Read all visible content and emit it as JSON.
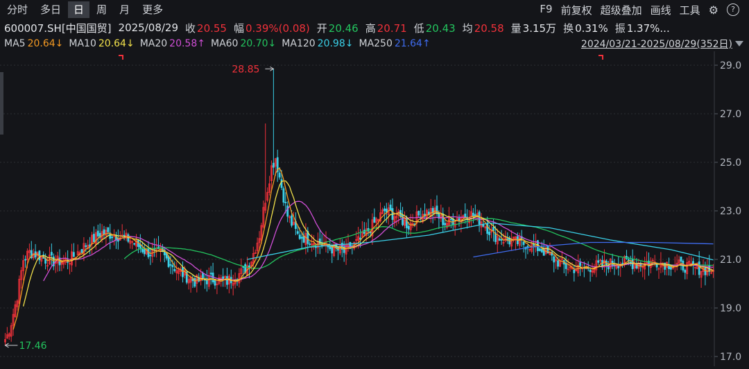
{
  "toolbar": {
    "tabs": [
      {
        "label": "分时",
        "active": false
      },
      {
        "label": "多日",
        "active": false
      },
      {
        "label": "日",
        "active": true
      },
      {
        "label": "周",
        "active": false
      },
      {
        "label": "月",
        "active": false
      },
      {
        "label": "更多",
        "active": false
      }
    ],
    "tools": [
      "F9",
      "前复权",
      "超级叠加",
      "画线",
      "工具"
    ],
    "settings_icon": "gear-icon",
    "help_icon": "question-icon",
    "help_glyph": "?"
  },
  "quote": {
    "symbol": "600007.SH[中国国贸]",
    "date": "2025/08/29",
    "close_label": "收",
    "close": "20.55",
    "change_label": "幅",
    "change": "0.39%(0.08)",
    "open_label": "开",
    "open": "20.46",
    "high_label": "高",
    "high": "20.71",
    "low_label": "低",
    "low": "20.43",
    "avg_label": "均",
    "avg": "20.58",
    "volume_label": "量",
    "volume": "3.15万",
    "turnover_label": "换",
    "turnover": "0.31%",
    "amplitude_label": "振",
    "amplitude": "1.37%..."
  },
  "ma_bar": {
    "items": [
      {
        "name": "MA5",
        "value": "20.64↓",
        "color": "#f59a23"
      },
      {
        "name": "MA10",
        "value": "20.64↓",
        "color": "#f2e14b"
      },
      {
        "name": "MA20",
        "value": "20.58↑",
        "color": "#d04fd6"
      },
      {
        "name": "MA60",
        "value": "20.70↓",
        "color": "#23c45e"
      },
      {
        "name": "MA120",
        "value": "20.98↓",
        "color": "#3ad0e8"
      },
      {
        "name": "MA250",
        "value": "21.64↑",
        "color": "#3f6cf0"
      }
    ],
    "range": "2024/03/21-2025/08/29(352日)"
  },
  "colors": {
    "up": "#f0313a",
    "down": "#3ad0e8",
    "grid": "#2c2e34",
    "axis_text": "#b4b8c0"
  },
  "chart_data": {
    "type": "candlestick",
    "y_ticks": [
      "29.0",
      "27.0",
      "25.0",
      "23.0",
      "21.0",
      "19.0",
      "17.0"
    ],
    "ylim": [
      17.0,
      29.0
    ],
    "high_marker": "28.85",
    "low_marker": "17.46",
    "high_value": 28.85,
    "low_value": 17.46,
    "sessions": 352,
    "close_path": [
      [
        0,
        17.6
      ],
      [
        3,
        18.4
      ],
      [
        6,
        19.5
      ],
      [
        9,
        21.0
      ],
      [
        12,
        21.3
      ],
      [
        16,
        21.2
      ],
      [
        20,
        21.0
      ],
      [
        25,
        20.9
      ],
      [
        32,
        21.0
      ],
      [
        40,
        21.6
      ],
      [
        48,
        22.1
      ],
      [
        55,
        22.0
      ],
      [
        62,
        21.8
      ],
      [
        70,
        21.3
      ],
      [
        78,
        21.2
      ],
      [
        86,
        20.5
      ],
      [
        94,
        20.1
      ],
      [
        102,
        20.2
      ],
      [
        110,
        20.1
      ],
      [
        118,
        20.5
      ],
      [
        122,
        21.0
      ],
      [
        126,
        22.0
      ],
      [
        129,
        23.5
      ],
      [
        132,
        24.8
      ],
      [
        134,
        25.2
      ],
      [
        137,
        24.0
      ],
      [
        140,
        22.8
      ],
      [
        145,
        22.0
      ],
      [
        152,
        21.8
      ],
      [
        160,
        21.5
      ],
      [
        168,
        21.3
      ],
      [
        176,
        21.8
      ],
      [
        182,
        22.4
      ],
      [
        188,
        23.0
      ],
      [
        194,
        22.8
      ],
      [
        200,
        22.4
      ],
      [
        206,
        22.9
      ],
      [
        212,
        23.0
      ],
      [
        218,
        22.5
      ],
      [
        224,
        22.7
      ],
      [
        230,
        22.9
      ],
      [
        236,
        22.6
      ],
      [
        242,
        22.0
      ],
      [
        248,
        21.8
      ],
      [
        254,
        21.7
      ],
      [
        260,
        21.6
      ],
      [
        266,
        21.4
      ],
      [
        272,
        21.0
      ],
      [
        278,
        20.7
      ],
      [
        284,
        20.6
      ],
      [
        290,
        20.7
      ],
      [
        298,
        20.8
      ],
      [
        306,
        20.9
      ],
      [
        314,
        20.8
      ],
      [
        322,
        20.9
      ],
      [
        330,
        20.8
      ],
      [
        338,
        20.7
      ],
      [
        345,
        20.6
      ],
      [
        351,
        20.55
      ]
    ],
    "ma_lines": [
      {
        "name": "MA120",
        "start": 120,
        "path": [
          [
            120,
            21.0
          ],
          [
            150,
            21.5
          ],
          [
            180,
            21.7
          ],
          [
            210,
            22.0
          ],
          [
            240,
            22.5
          ],
          [
            270,
            22.3
          ],
          [
            300,
            21.8
          ],
          [
            330,
            21.4
          ],
          [
            351,
            20.98
          ]
        ]
      },
      {
        "name": "MA250",
        "start": 232,
        "path": [
          [
            232,
            21.1
          ],
          [
            260,
            21.5
          ],
          [
            290,
            21.7
          ],
          [
            320,
            21.7
          ],
          [
            351,
            21.64
          ]
        ]
      }
    ]
  }
}
